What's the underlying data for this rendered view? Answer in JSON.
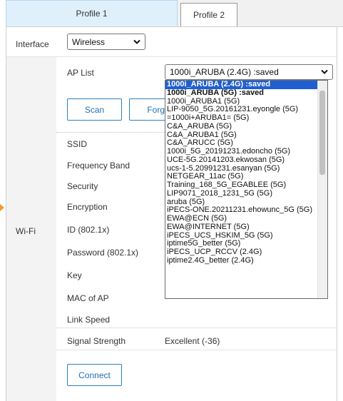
{
  "tabs": [
    {
      "label": "Profile 1"
    },
    {
      "label": "Profile 2"
    }
  ],
  "interface": {
    "label": "Interface",
    "value": "Wireless"
  },
  "wifi": {
    "section_label": "Wi-Fi"
  },
  "ap_list": {
    "label": "AP List",
    "value": "1000i_ARUBA (2.4G) :saved"
  },
  "buttons": {
    "scan": "Scan",
    "forget_partial": "Forg",
    "connect": "Connect"
  },
  "fields": [
    {
      "label": "SSID"
    },
    {
      "label": "Frequency Band"
    },
    {
      "label": "Security"
    },
    {
      "label": "Encryption"
    },
    {
      "label": "ID (802.1x)"
    },
    {
      "label": "Password (802.1x)"
    },
    {
      "label": "Key"
    },
    {
      "label": "MAC of AP"
    },
    {
      "label": "Link Speed"
    },
    {
      "label": "Signal Strength",
      "value": "Excellent (-36)"
    }
  ],
  "dropdown_options": [
    "1000i_ARUBA (2.4G) :saved",
    "1000i_ARUBA (5G) :saved",
    "1000i_ARUBA1 (5G)",
    "LIP-9050_5G.20161231.eyongle (5G)",
    "=1000i+ARUBA1= (5G)",
    "C&A_ARUBA (5G)",
    "C&A_ARUBA1 (5G)",
    "C&A_ARUCC (5G)",
    "1000i_5G_20191231.edoncho (5G)",
    "UCE-5G.20141203.ekwosan (5G)",
    "ucs-1-5.20991231.esanyan (5G)",
    "NETGEAR_11ac (5G)",
    "Training_168_5G_EGABLEE (5G)",
    "LIP9071_2018_1231_5G (5G)",
    "aruba (5G)",
    "iPECS-ONE.20211231.ehowunc_5G (5G)",
    "EWA@ECN (5G)",
    "EWA@INTERNET (5G)",
    "iPECS_UCS_HSKIM_5G (5G)",
    "iptime5G_better (5G)",
    "iPECS_UCP_RCCV (2.4G)",
    "iptime2.4G_better (2.4G)"
  ],
  "colors": {
    "selected_option": "#1f5fd1",
    "button_border": "#2a7fc1",
    "tab_active": "#dff0fb",
    "indicator": "#f39a2e"
  }
}
